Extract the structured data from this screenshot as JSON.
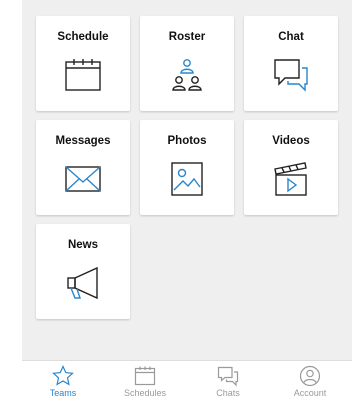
{
  "tiles": [
    {
      "label": "Schedule",
      "icon": "calendar-icon"
    },
    {
      "label": "Roster",
      "icon": "roster-people-icon"
    },
    {
      "label": "Chat",
      "icon": "chat-bubbles-icon"
    },
    {
      "label": "Messages",
      "icon": "envelope-icon"
    },
    {
      "label": "Photos",
      "icon": "photo-icon"
    },
    {
      "label": "Videos",
      "icon": "video-clapper-icon"
    },
    {
      "label": "News",
      "icon": "megaphone-icon"
    }
  ],
  "tabbar": {
    "items": [
      {
        "label": "Teams",
        "icon": "star-icon",
        "active": true
      },
      {
        "label": "Schedules",
        "icon": "calendar-icon",
        "active": false
      },
      {
        "label": "Chats",
        "icon": "chat-bubbles-icon",
        "active": false
      },
      {
        "label": "Account",
        "icon": "account-icon",
        "active": false
      }
    ]
  },
  "colors": {
    "accent": "#2a86cc",
    "icon_dark": "#222222",
    "tab_inactive": "#9a9a9a",
    "background": "#efefef"
  }
}
